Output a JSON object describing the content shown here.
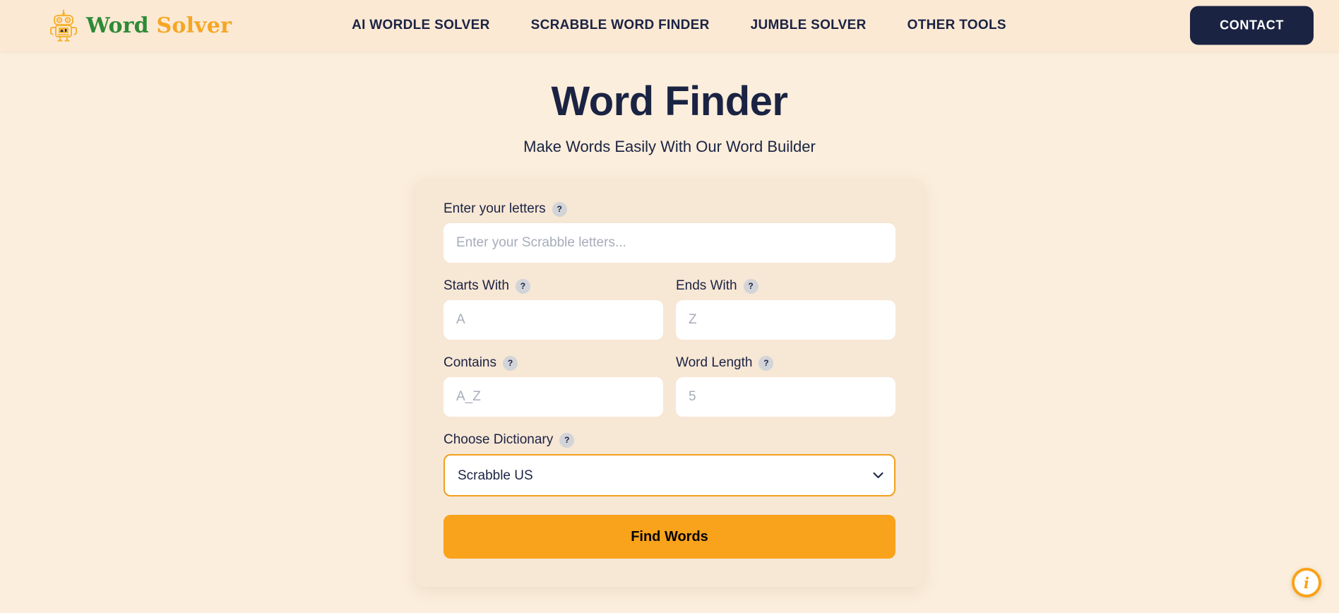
{
  "header": {
    "logo": {
      "icon": "robot-icon",
      "word": "Word",
      "solver": "Solver"
    },
    "nav": [
      {
        "label": "AI WORDLE SOLVER"
      },
      {
        "label": "SCRABBLE WORD FINDER"
      },
      {
        "label": "JUMBLE SOLVER"
      },
      {
        "label": "OTHER TOOLS"
      }
    ],
    "contact_label": "CONTACT"
  },
  "hero": {
    "title": "Word Finder",
    "subtitle": "Make Words Easily With Our Word Builder"
  },
  "form": {
    "letters": {
      "label": "Enter your letters",
      "help": "?",
      "placeholder": "Enter your Scrabble letters...",
      "value": ""
    },
    "starts_with": {
      "label": "Starts With",
      "help": "?",
      "placeholder": "A",
      "value": ""
    },
    "ends_with": {
      "label": "Ends With",
      "help": "?",
      "placeholder": "Z",
      "value": ""
    },
    "contains": {
      "label": "Contains",
      "help": "?",
      "placeholder": "A_Z",
      "value": ""
    },
    "word_length": {
      "label": "Word Length",
      "help": "?",
      "placeholder": "5",
      "value": ""
    },
    "dictionary": {
      "label": "Choose Dictionary",
      "help": "?",
      "selected": "Scrabble US",
      "chevron_icon": "chevron-down-icon"
    },
    "submit_label": "Find Words"
  },
  "floating": {
    "info_icon": "info-icon",
    "info_label": "i"
  },
  "colors": {
    "page_bg": "#fbeedc",
    "header_bg": "#fbe9d4",
    "card_bg": "#f7e7d5",
    "navy": "#1b2343",
    "orange": "#f9a21b",
    "green": "#2d8a36",
    "help_badge": "#d2d4d8"
  }
}
